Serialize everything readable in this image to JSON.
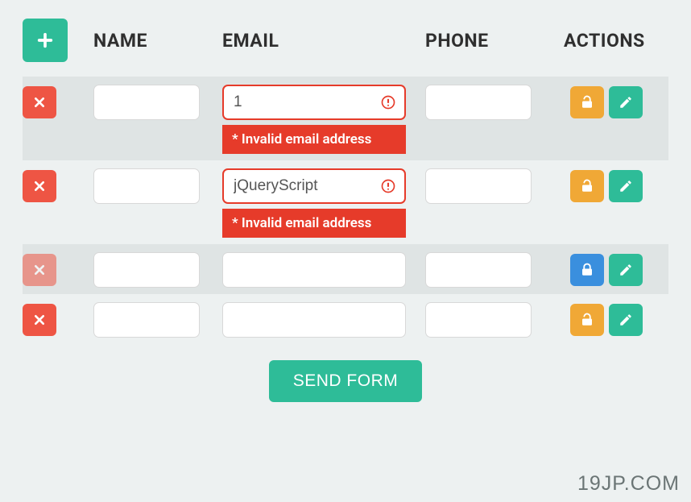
{
  "headers": {
    "name": "NAME",
    "email": "EMAIL",
    "phone": "PHONE",
    "actions": "ACTIONS"
  },
  "rows": [
    {
      "shaded": true,
      "name": "",
      "email": "1",
      "phone": "",
      "emailError": true,
      "errorMsg": "* Invalid email address",
      "locked": false,
      "delDisabled": false
    },
    {
      "shaded": false,
      "name": "",
      "email": "jQueryScript",
      "phone": "",
      "emailError": true,
      "errorMsg": "* Invalid email address",
      "locked": false,
      "delDisabled": false
    },
    {
      "shaded": true,
      "name": "",
      "email": "",
      "phone": "",
      "emailError": false,
      "errorMsg": "",
      "locked": true,
      "delDisabled": true
    },
    {
      "shaded": false,
      "name": "",
      "email": "",
      "phone": "",
      "emailError": false,
      "errorMsg": "",
      "locked": false,
      "delDisabled": false
    }
  ],
  "submit": {
    "label": "SEND FORM"
  },
  "watermark": "19JP.COM"
}
